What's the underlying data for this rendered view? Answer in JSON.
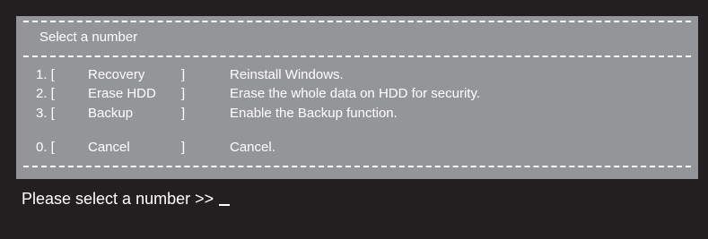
{
  "menu": {
    "title": "Select a number",
    "items": [
      {
        "number": "1. [",
        "label": "Recovery",
        "close": "]",
        "description": "Reinstall Windows."
      },
      {
        "number": "2. [",
        "label": "Erase HDD",
        "close": "]",
        "description": "Erase the whole data on HDD for security."
      },
      {
        "number": "3. [",
        "label": "Backup",
        "close": "]",
        "description": "Enable the Backup function."
      },
      {
        "number": "0. [",
        "label": "Cancel",
        "close": "]",
        "description": "Cancel."
      }
    ]
  },
  "prompt": {
    "text": "Please select a number >>"
  },
  "colors": {
    "screen_background": "#231f20",
    "panel_background": "#939598",
    "text": "#ffffff"
  }
}
